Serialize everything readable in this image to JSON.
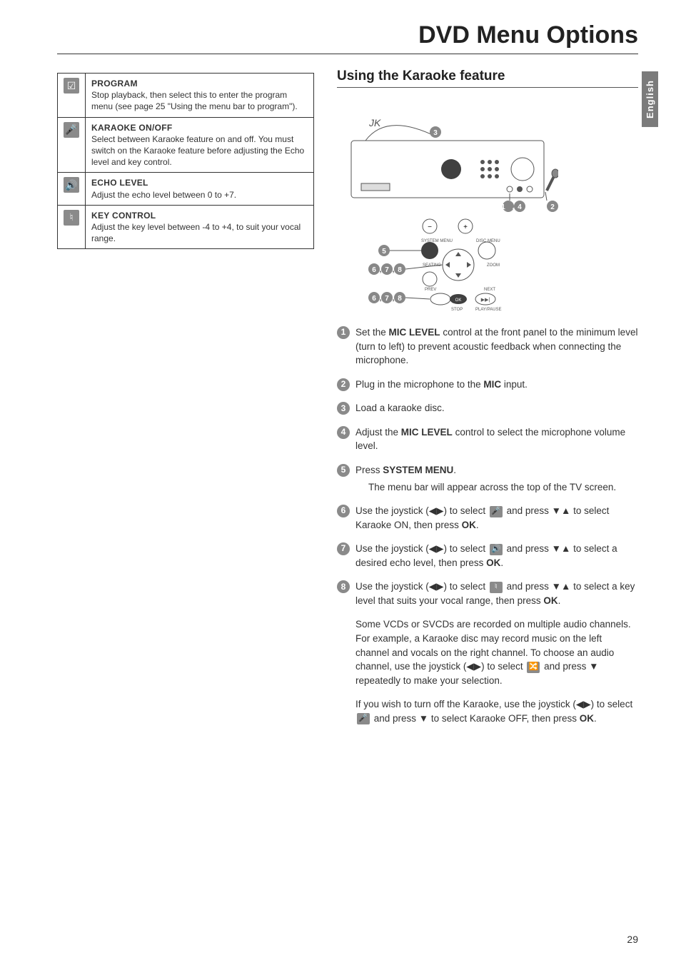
{
  "title": "DVD Menu Options",
  "language_tab": "English",
  "page_number": "29",
  "table": {
    "rows": [
      {
        "icon": "☑",
        "icon_name": "program-icon",
        "title": "PROGRAM",
        "desc": "Stop playback, then select this to enter the program menu (see page 25 \"Using the menu bar to program\")."
      },
      {
        "icon": "🎤",
        "icon_name": "karaoke-icon",
        "title": "KARAOKE ON/OFF",
        "desc": "Select between Karaoke feature on and off. You must switch on the Karaoke feature before adjusting the Echo level and key control."
      },
      {
        "icon": "🔊",
        "icon_name": "echo-level-icon",
        "title": "ECHO LEVEL",
        "desc": "Adjust the echo level between 0 to +7."
      },
      {
        "icon": "♮",
        "icon_name": "key-control-icon",
        "title": "KEY CONTROL",
        "desc": "Adjust the key level between -4 to +4, to suit your vocal range."
      }
    ]
  },
  "section": {
    "heading": "Using the Karaoke feature",
    "diagram": {
      "callouts": [
        "1",
        "2",
        "3",
        "4",
        "5",
        "6",
        "7",
        "8"
      ],
      "callout_group_a": "1,4",
      "callout_group_b": "6,7,8",
      "labels": {
        "system_menu": "SYSTEM MENU",
        "disc_menu": "DISC MENU",
        "seating": "SEATING",
        "zoom": "ZOOM",
        "prev": "PREV",
        "next": "NEXT",
        "stop": "STOP",
        "play_pause": "PLAY/PAUSE",
        "ok": "OK"
      }
    },
    "steps": [
      {
        "pre": "Set the ",
        "bold1": "MIC LEVEL",
        "post": " control at the front panel to the minimum level (turn to left) to prevent acoustic feedback when connecting the microphone."
      },
      {
        "pre": "Plug in the microphone to the ",
        "bold1": "MIC",
        "post": " input."
      },
      {
        "pre": "Load a karaoke disc.",
        "bold1": "",
        "post": ""
      },
      {
        "pre": "Adjust the ",
        "bold1": "MIC LEVEL",
        "post": " control to select the microphone volume level."
      },
      {
        "pre": "Press ",
        "bold1": "SYSTEM MENU",
        "post": ".",
        "sub": "The menu bar will appear across the top of the TV screen."
      },
      {
        "pre": "Use the joystick (◀▶) to select ",
        "icon": "🎤",
        "mid": " and press ▼▲ to select Karaoke ON, then press ",
        "bold2": "OK",
        "post": "."
      },
      {
        "pre": "Use the joystick (◀▶) to select ",
        "icon": "🔊",
        "mid": " and press ▼▲ to select a desired echo level, then press ",
        "bold2": "OK",
        "post": "."
      },
      {
        "pre": "Use the joystick (◀▶) to select ",
        "icon": "♮",
        "mid": " and press ▼▲ to select a key level that suits your vocal range, then press ",
        "bold2": "OK",
        "post": "."
      }
    ],
    "note1": {
      "pre": "Some VCDs or SVCDs are recorded on multiple audio channels.  For example, a Karaoke disc may record music on the left channel and vocals on the right channel.  To choose an audio channel, use the joystick (◀▶) to select ",
      "icon": "🔀",
      "post": " and press ▼ repeatedly to make your selection."
    },
    "note2": {
      "pre": "If you wish to turn off the Karaoke, use the joystick (◀▶) to select ",
      "icon": "🎤",
      "mid": " and press ▼ to select Karaoke OFF, then press ",
      "bold": "OK",
      "post": "."
    }
  }
}
